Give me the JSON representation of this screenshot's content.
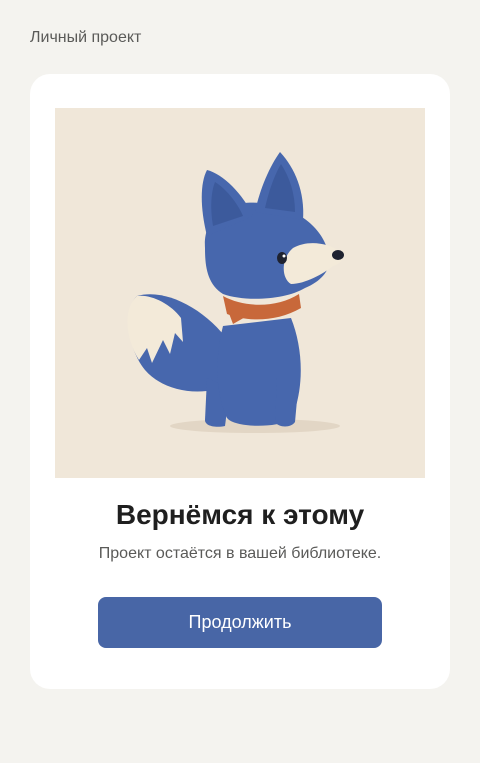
{
  "header": {
    "label": "Личный проект"
  },
  "card": {
    "illustration": "blue-fox-mascot",
    "title": "Вернёмся к этому",
    "subtitle": "Проект остаётся в вашей библиотеке.",
    "button_label": "Продолжить"
  },
  "colors": {
    "page_background": "#f4f3ef",
    "card_background": "#ffffff",
    "illustration_background": "#f0e7d9",
    "fox_blue": "#4767ad",
    "scarf": "#c8683a",
    "button": "#4866a6"
  }
}
